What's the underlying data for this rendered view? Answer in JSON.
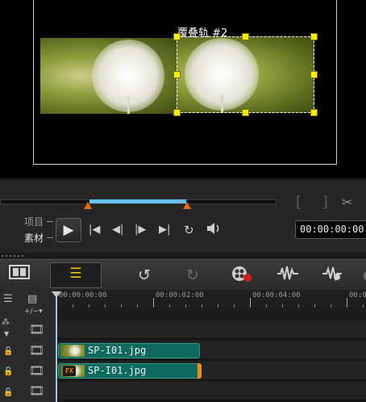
{
  "preview": {
    "overlay_label": "覆叠轨 #2"
  },
  "playback": {
    "mode_project": "项目",
    "mode_clip": "素材",
    "timecode": "00:00:00:00"
  },
  "ruler": {
    "labels": [
      "00:00:00:00",
      "00:00:02:00",
      "00:00:04:00",
      "00:00:0"
    ]
  },
  "tracks": {
    "clip_overlay": "SP-I01.jpg",
    "clip_video": "SP-I01.jpg"
  },
  "icons": {
    "play": "play-icon",
    "timeline_toggle": "timeline-view-icon",
    "undo": "undo-icon",
    "redo": "redo-icon",
    "record": "record-capture-icon",
    "audio": "sound-mix-icon",
    "auto_music": "auto-music-icon"
  },
  "colors": {
    "clip_fill": "#0e6a5e",
    "accent_range": "#63c0ef",
    "marker": "#e06c11",
    "selection_handle": "#ffee00"
  }
}
